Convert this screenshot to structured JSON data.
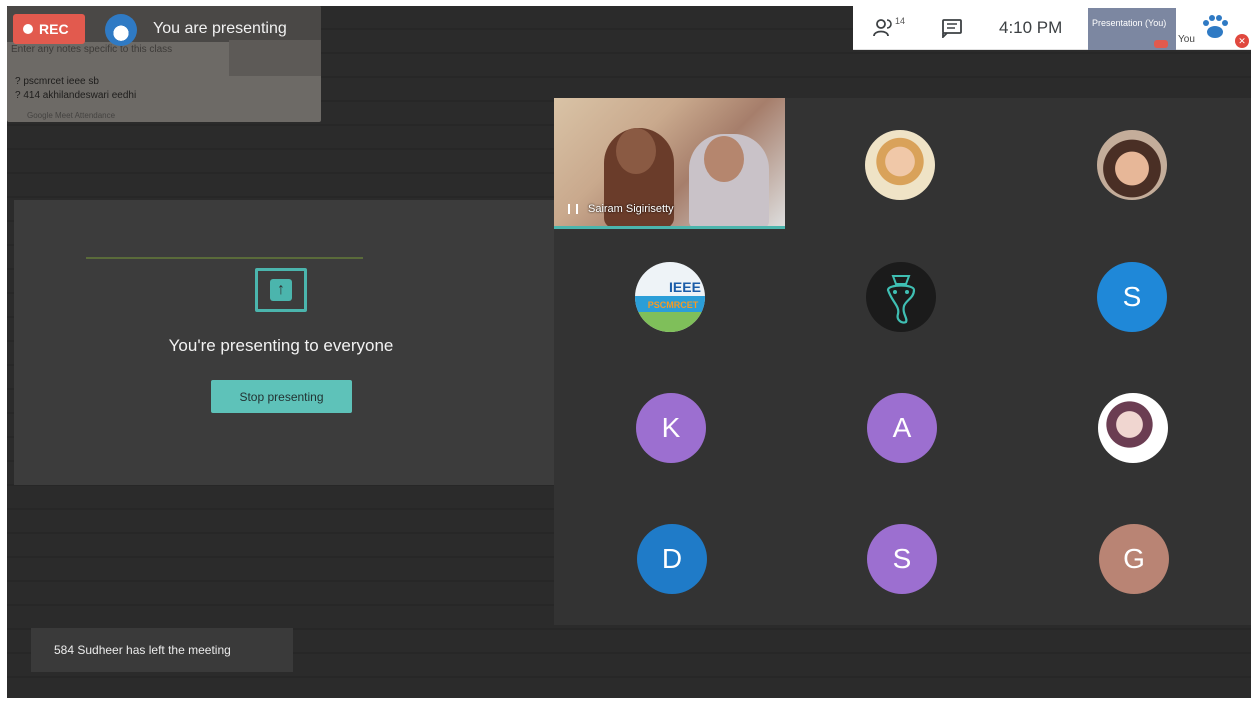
{
  "recording": {
    "label": "REC"
  },
  "presenter_bar": {
    "status": "You are presenting"
  },
  "notes_panel": {
    "hint": "Enter any notes specific to this class",
    "lines": [
      "? pscmrcet ieee sb",
      "? 414 akhilandeswari eedhi"
    ],
    "footer": "Google Meet Attendance"
  },
  "top_bar": {
    "participant_count": "14",
    "time": "4:10 PM",
    "presentation_label": "Presentation (You)",
    "you_label": "You"
  },
  "presenting_panel": {
    "title": "You're presenting to everyone",
    "stop_button": "Stop presenting"
  },
  "video_tile": {
    "name": "Sairam Sigirisetty"
  },
  "participants": [
    {
      "kind": "photo",
      "icon": "woman-portrait-avatar"
    },
    {
      "kind": "photo",
      "icon": "girl-portrait-avatar"
    },
    {
      "kind": "photo",
      "icon": "ieee-logo-avatar"
    },
    {
      "kind": "photo",
      "icon": "ganesha-logo-avatar"
    },
    {
      "kind": "letter",
      "letter": "S",
      "color": "#1f88d8"
    },
    {
      "kind": "letter",
      "letter": "K",
      "color": "#9c6fd0"
    },
    {
      "kind": "letter",
      "letter": "A",
      "color": "#9c6fd0"
    },
    {
      "kind": "photo",
      "icon": "pink-portrait-avatar"
    },
    {
      "kind": "letter",
      "letter": "D",
      "color": "#1f7bc8"
    },
    {
      "kind": "letter",
      "letter": "S",
      "color": "#9c6fd0"
    },
    {
      "kind": "letter",
      "letter": "G",
      "color": "#b98474"
    }
  ],
  "ieee_logo": {
    "line1": "IEEE",
    "line2": "PSCMRCET"
  },
  "toast": {
    "message": "584 Sudheer has left the meeting"
  },
  "colors": {
    "accent": "#4bb5ad",
    "rec": "#e25a4e",
    "background": "#2b2b2b"
  }
}
